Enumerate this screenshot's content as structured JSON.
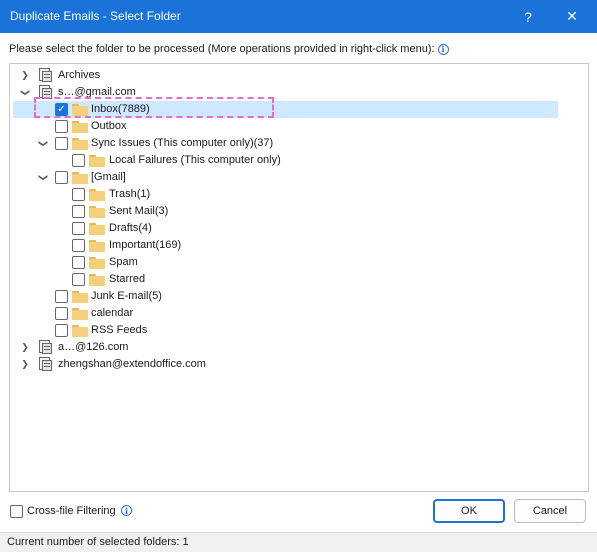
{
  "window": {
    "title": "Duplicate Emails - Select Folder",
    "help_glyph": "?",
    "close_glyph": "✕"
  },
  "prompt": {
    "text": "Please select the folder to be processed (More operations provided in right-click menu):"
  },
  "tree": {
    "archives": "Archives",
    "account1": "s…@gmail.com",
    "inbox": "Inbox(7889)",
    "outbox": "Outbox",
    "sync_issues": "Sync Issues (This computer only)(37)",
    "local_failures": "Local Failures (This computer only)",
    "gmail": "[Gmail]",
    "trash": "Trash(1)",
    "sent_mail": "Sent Mail(3)",
    "drafts": "Drafts(4)",
    "important": "Important(169)",
    "spam": "Spam",
    "starred": "Starred",
    "junk": "Junk E-mail(5)",
    "calendar": "calendar",
    "rss": "RSS Feeds",
    "account2": "a…@126.com",
    "account3": "zhengshan@extendoffice.com"
  },
  "footer": {
    "cross_file_label": "Cross-file Filtering",
    "ok_label": "OK",
    "cancel_label": "Cancel",
    "status": "Current number of selected folders: 1"
  },
  "colors": {
    "titlebar": "#1a73d9",
    "selected_row": "#cde8ff",
    "highlight_border": "#e46bd0",
    "folder": "#f5cf7a"
  }
}
